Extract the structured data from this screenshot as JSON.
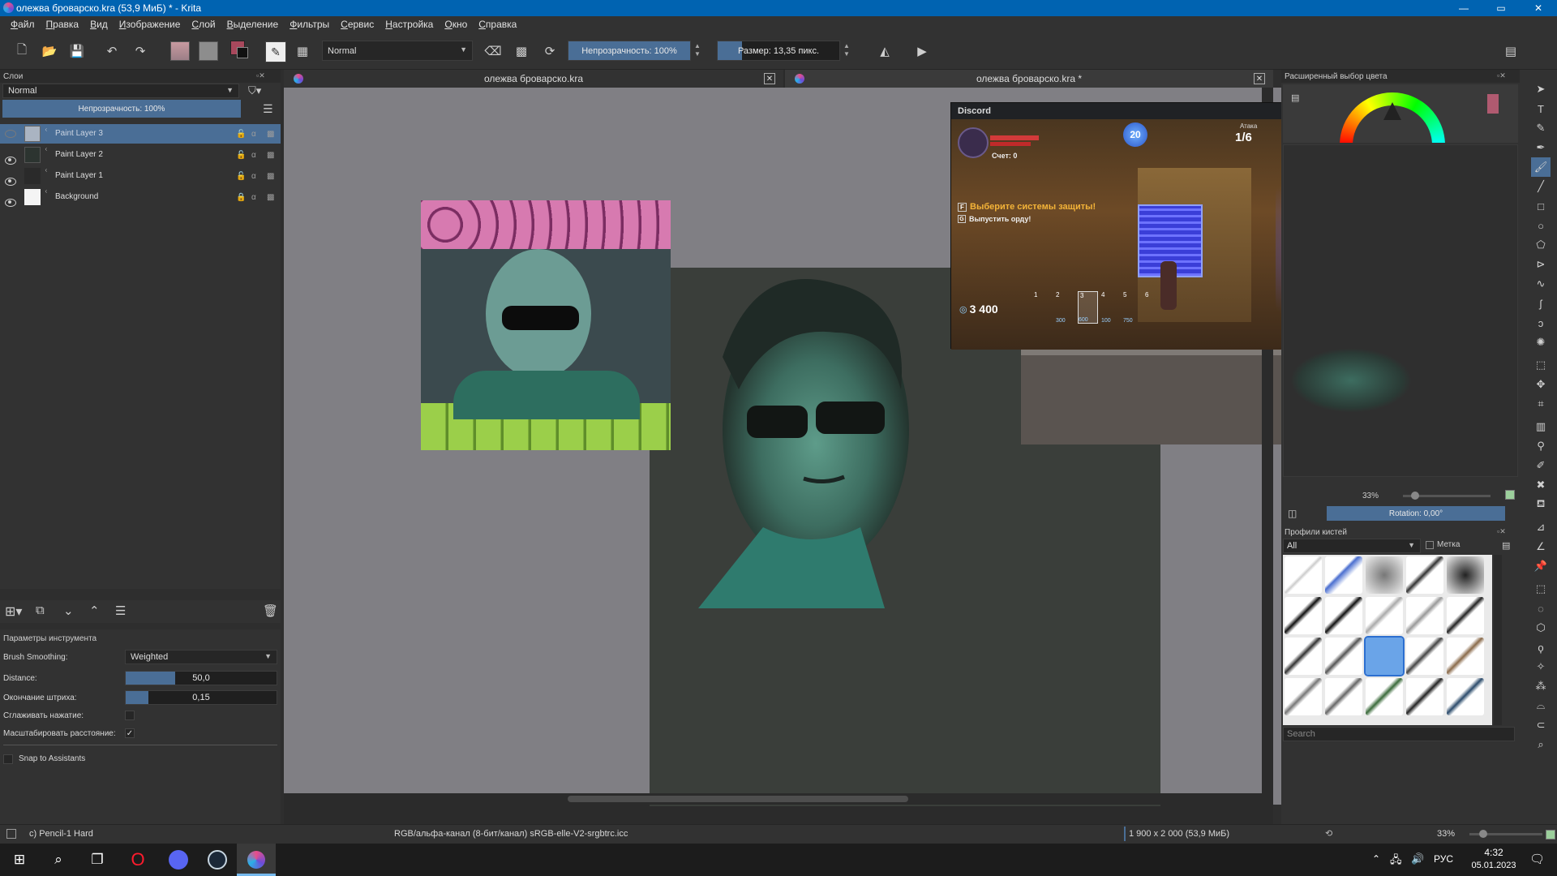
{
  "window": {
    "title": "олежва броварско.kra (53,9 МиБ)  * - Krita",
    "minimize": "—",
    "maximize": "▭",
    "close": "✕"
  },
  "menubar": [
    "Файл",
    "Правка",
    "Вид",
    "Изображение",
    "Слой",
    "Выделение",
    "Фильтры",
    "Сервис",
    "Настройка",
    "Окно",
    "Справка"
  ],
  "toolbar": {
    "blend_mode": "Normal",
    "opacity": "Непрозрачность: 100%",
    "size": "Размер: 13,35 пикс."
  },
  "layers_panel": {
    "title": "Слои",
    "blend_mode": "Normal",
    "opacity": "Непрозрачность:  100%",
    "layers": [
      {
        "name": "Paint Layer 3",
        "selected": true
      },
      {
        "name": "Paint Layer 2",
        "selected": false
      },
      {
        "name": "Paint Layer 1",
        "selected": false
      },
      {
        "name": "Background",
        "selected": false
      }
    ]
  },
  "tool_options": {
    "title": "Параметры инструмента",
    "brush_smoothing_label": "Brush Smoothing:",
    "brush_smoothing_value": "Weighted",
    "distance_label": "Distance:",
    "distance_value": "50,0",
    "distance_fill": 0.33,
    "stroke_end_label": "Окончание штриха:",
    "stroke_end_value": "0,15",
    "stroke_end_fill": 0.15,
    "smooth_pressure_label": "Сглаживать нажатие:",
    "scale_distance_label": "Масштабировать расстояние:",
    "snap_label": "Snap to Assistants"
  },
  "doc_tabs": [
    {
      "label": "олежва броварско.kra"
    },
    {
      "label": "олежва броварско.kra *"
    }
  ],
  "color_selector": {
    "title": "Расширенный выбор цвета"
  },
  "overview": {
    "zoom": "33%",
    "rotation": "Rotation: 0,00°"
  },
  "brush_presets": {
    "title": "Профили кистей",
    "filter": "All",
    "tag_label": "Метка",
    "search_placeholder": "Search"
  },
  "discord": {
    "title": "Discord",
    "score": "Счет: 0",
    "wave": "1/6",
    "wave_label": "Атака",
    "level": "20",
    "quest_main": "Выберите системы защиты!",
    "quest_sub": "Выпустить орду!",
    "key1": "F",
    "key2": "G",
    "money": "3 400",
    "slots": [
      "1",
      "2",
      "3",
      "4",
      "5",
      "6"
    ],
    "prices": [
      "300",
      "600",
      "100",
      "750"
    ]
  },
  "statusbar": {
    "brush": "c) Pencil-1 Hard",
    "color_space": "RGB/альфа-канал (8-бит/канал)  sRGB-elle-V2-srgbtrc.icc",
    "dimensions": "1 900 x 2 000 (53,9 МиБ)",
    "zoom": "33%"
  },
  "taskbar": {
    "lang": "РУС",
    "time": "4:32",
    "date": "05.01.2023"
  },
  "colors": {
    "accent": "#0063b1",
    "selection": "#4a6e96",
    "panel": "#323232",
    "canvas_bg": "#807f84"
  }
}
